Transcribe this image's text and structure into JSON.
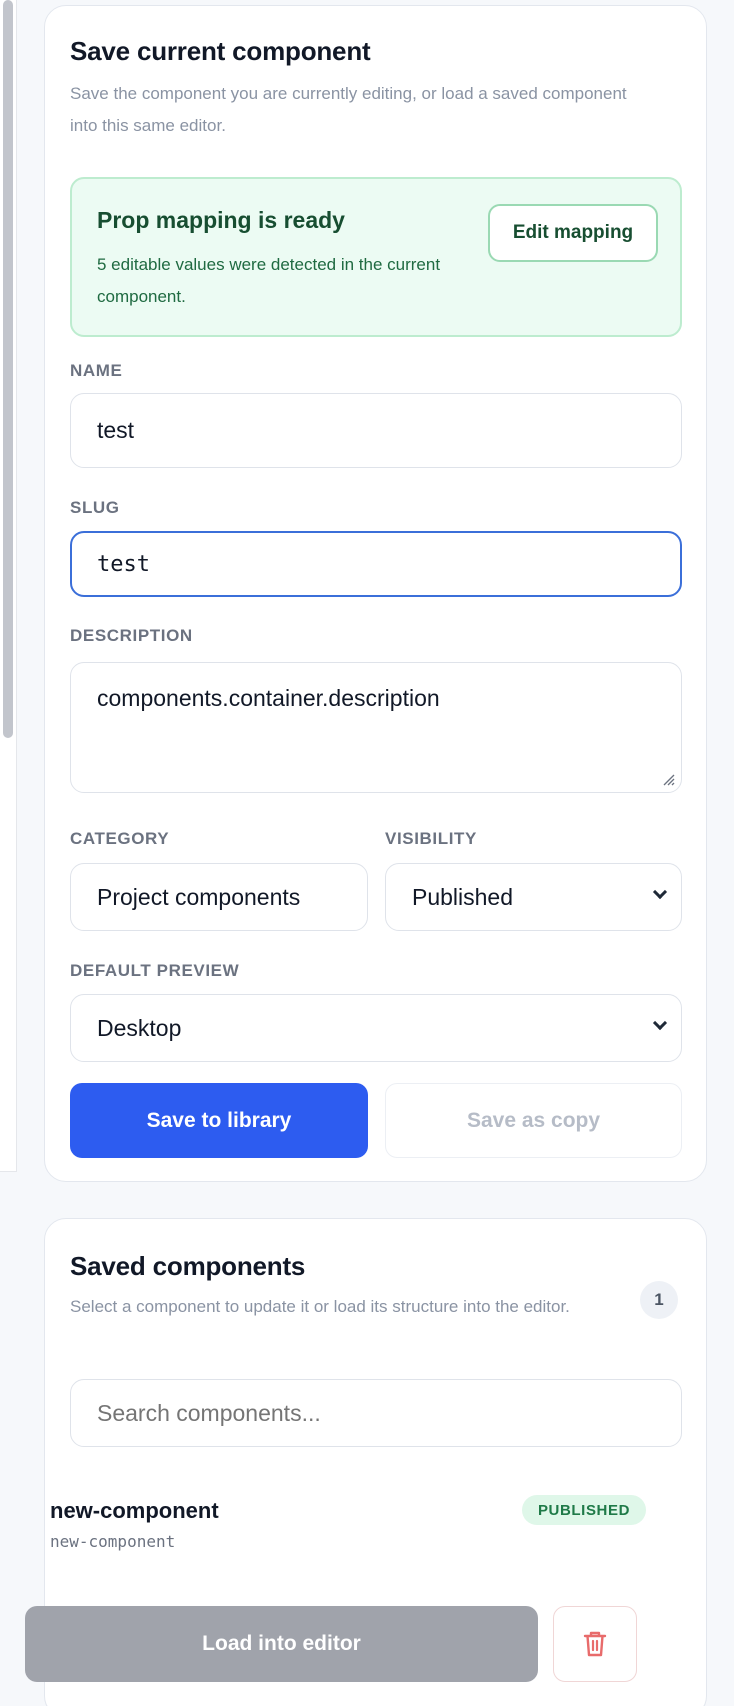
{
  "save_panel": {
    "title": "Save current component",
    "subtitle": "Save the component you are currently editing, or load a saved component into this same editor.",
    "prop_mapping": {
      "title": "Prop mapping is ready",
      "text": "5 editable values were detected in the current component.",
      "edit_button": "Edit mapping"
    },
    "fields": {
      "name": {
        "label": "NAME",
        "value": "test"
      },
      "slug": {
        "label": "SLUG",
        "value": "test"
      },
      "description": {
        "label": "DESCRIPTION",
        "value": "components.container.description"
      },
      "category": {
        "label": "CATEGORY",
        "value": "Project components"
      },
      "visibility": {
        "label": "VISIBILITY",
        "value": "Published"
      },
      "default_preview": {
        "label": "DEFAULT PREVIEW",
        "value": "Desktop"
      }
    },
    "save_button": "Save to library",
    "save_copy_button": "Save as copy"
  },
  "saved_panel": {
    "title": "Saved components",
    "subtitle": "Select a component to update it or load its structure into the editor.",
    "count": "1",
    "search_placeholder": "Search components...",
    "items": [
      {
        "name": "new-component",
        "slug": "new-component",
        "status": "PUBLISHED"
      }
    ],
    "load_button": "Load into editor"
  },
  "colors": {
    "accent": "#2d5cf0",
    "success_bg": "#ecfbf3",
    "danger": "#e86b6b"
  }
}
